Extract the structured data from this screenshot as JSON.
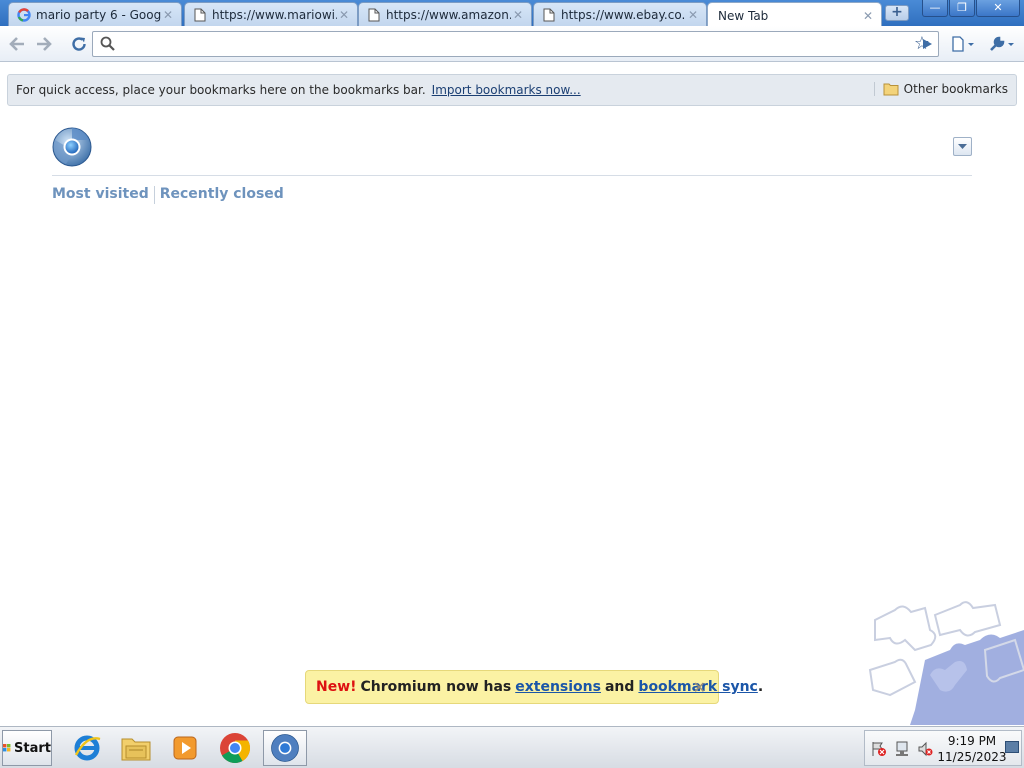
{
  "tabs": [
    {
      "title": "mario party 6 - Googl...",
      "icon": "google-g-icon"
    },
    {
      "title": "https://www.mariowi...",
      "icon": "page-icon"
    },
    {
      "title": "https://www.amazon....",
      "icon": "page-icon"
    },
    {
      "title": "https://www.ebay.co...",
      "icon": "page-icon"
    },
    {
      "title": "New Tab",
      "icon": "none"
    }
  ],
  "omnibox": {
    "value": "",
    "placeholder": ""
  },
  "bookmarks_bar": {
    "message": "For quick access, place your bookmarks here on the bookmarks bar.",
    "import_link": "Import bookmarks now...",
    "other_bookmarks": "Other bookmarks"
  },
  "ntp": {
    "tab_most_visited": "Most visited",
    "tab_recently_closed": "Recently closed"
  },
  "promo": {
    "new_label": "New!",
    "text_before": "Chromium now has",
    "link_extensions": "extensions",
    "text_and": "and",
    "link_sync": "bookmark sync",
    "period": "."
  },
  "taskbar": {
    "start_label": "Start",
    "time": "9:19 PM",
    "date": "11/25/2023"
  },
  "colors": {
    "titlebar": "#3a7ccc",
    "promo_bg": "#fbf2a4",
    "ntp_link": "#6e93bd"
  }
}
